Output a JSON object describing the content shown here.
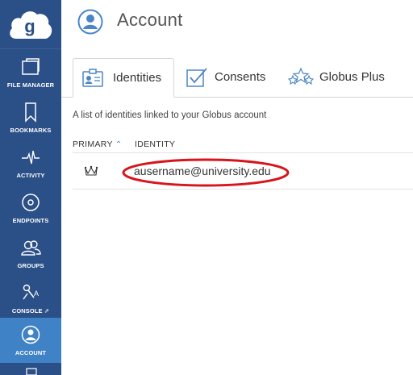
{
  "sidebar": {
    "items": [
      {
        "label": "FILE MANAGER",
        "icon": "folder-icon"
      },
      {
        "label": "BOOKMARKS",
        "icon": "bookmark-icon"
      },
      {
        "label": "ACTIVITY",
        "icon": "activity-icon"
      },
      {
        "label": "ENDPOINTS",
        "icon": "endpoint-icon"
      },
      {
        "label": "GROUPS",
        "icon": "groups-icon"
      },
      {
        "label": "CONSOLE",
        "icon": "console-icon"
      },
      {
        "label": "ACCOUNT",
        "icon": "account-icon"
      }
    ]
  },
  "header": {
    "title": "Account"
  },
  "tabs": [
    {
      "label": "Identities"
    },
    {
      "label": "Consents"
    },
    {
      "label": "Globus Plus"
    }
  ],
  "description": "A list of identities linked to your Globus account",
  "table": {
    "columns": [
      "PRIMARY",
      "IDENTITY"
    ],
    "rows": [
      {
        "identity": "ausername@university.edu"
      }
    ]
  },
  "colors": {
    "sidebar": "#2b4f87",
    "active": "#3f82c6",
    "annotation": "#d9141b"
  }
}
